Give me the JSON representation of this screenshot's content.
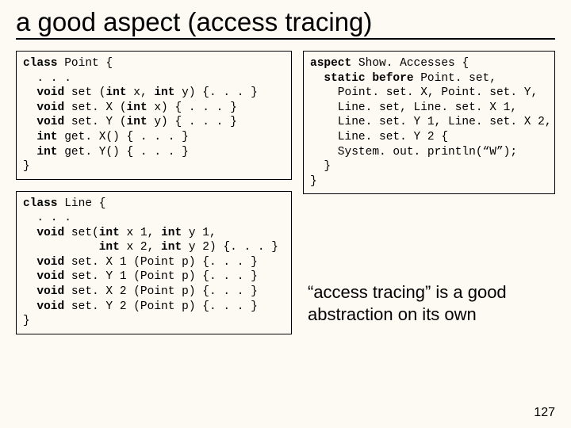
{
  "title": "a good aspect (access tracing)",
  "pagenum": "127",
  "note_line1": "“access tracing” is a good",
  "note_line2": "abstraction on its own",
  "code": {
    "point": {
      "l1a": "class",
      "l1b": " Point {",
      "l2": "  . . .",
      "l3a": "  void",
      "l3b": " set (",
      "l3c": "int",
      "l3d": " x, ",
      "l3e": "int",
      "l3f": " y) {. . . }",
      "l4a": "  void",
      "l4b": " set. X (",
      "l4c": "int",
      "l4d": " x) { . . . }",
      "l5a": "  void",
      "l5b": " set. Y (",
      "l5c": "int",
      "l5d": " y) { . . . }",
      "l6a": "  int",
      "l6b": " get. X() { . . . }",
      "l7a": "  int",
      "l7b": " get. Y() { . . . }",
      "l8": "}"
    },
    "line": {
      "l1a": "class",
      "l1b": " Line {",
      "l2": "  . . .",
      "l3a": "  void",
      "l3b": " set(",
      "l3c": "int",
      "l3d": " x 1, ",
      "l3e": "int",
      "l3f": " y 1,",
      "l4a": "           ",
      "l4b": "int",
      "l4c": " x 2, ",
      "l4d": "int",
      "l4e": " y 2) {. . . }",
      "l5a": "  void",
      "l5b": " set. X 1 (Point p) {. . . }",
      "l6a": "  void",
      "l6b": " set. Y 1 (Point p) {. . . }",
      "l7a": "  void",
      "l7b": " set. X 2 (Point p) {. . . }",
      "l8a": "  void",
      "l8b": " set. Y 2 (Point p) {. . . }",
      "l9": "}"
    },
    "aspect": {
      "l1a": "aspect",
      "l1b": " Show. Accesses {",
      "l2a": "  static before",
      "l2b": " Point. set,",
      "l3": "    Point. set. X, Point. set. Y,",
      "l4": "    Line. set, Line. set. X 1,",
      "l5": "    Line. set. Y 1, Line. set. X 2,",
      "l6": "    Line. set. Y 2 {",
      "l7": "    System. out. println(“W”);",
      "l8": "  }",
      "l9": "}"
    }
  }
}
